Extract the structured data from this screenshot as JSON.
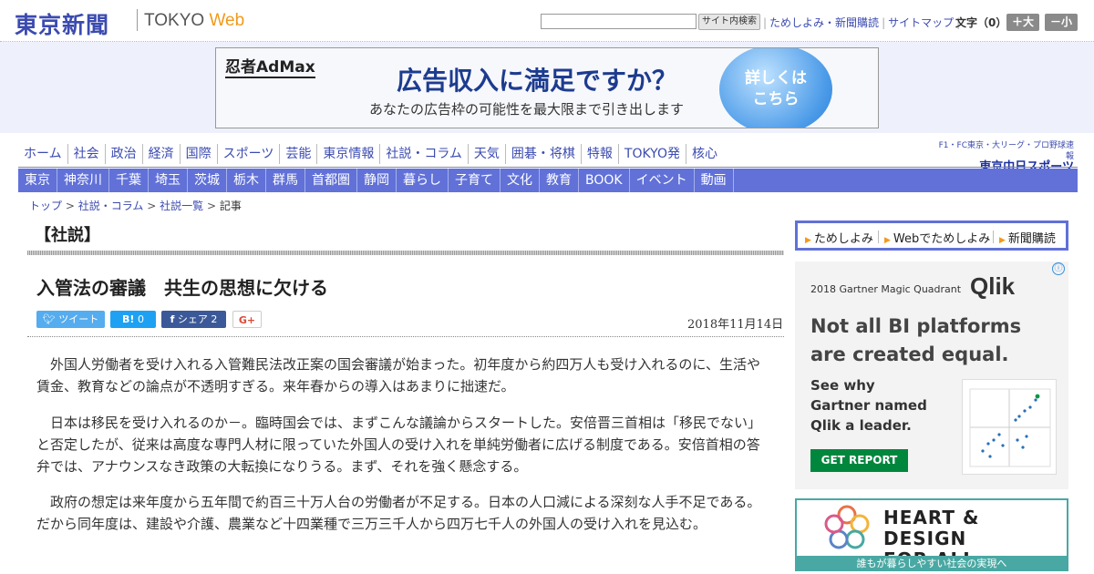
{
  "header": {
    "logo_jp": "東京新聞",
    "logo_en": "TOKYO",
    "logo_web": "Web",
    "search_button": "サイト内検索",
    "search_value": "",
    "link_trial": "ためしよみ・新聞購読",
    "link_sitemap": "サイトマップ",
    "font_size_label": "文字（0）",
    "size_up": "＋大",
    "size_down": "－小"
  },
  "top_ad": {
    "brand": "忍者AdMax",
    "headline": "広告収入に満足ですか？",
    "sub": "あなたの広告枠の可能性を最大限まで引き出します",
    "cta_line1": "詳しくは",
    "cta_line2": "こちら"
  },
  "nav_primary": [
    "ホーム",
    "社会",
    "政治",
    "経済",
    "国際",
    "スポーツ",
    "芸能",
    "東京情報",
    "社説・コラム",
    "天気",
    "囲碁・将棋",
    "特報",
    "TOKYO発",
    "核心"
  ],
  "sports_link": {
    "caption": "F1・FC東京・大リーグ・プロ野球速報",
    "logo": "東京中日スポーツ"
  },
  "nav_regional": [
    "東京",
    "神奈川",
    "千葉",
    "埼玉",
    "茨城",
    "栃木",
    "群馬",
    "首都圏",
    "静岡",
    "暮らし",
    "子育て",
    "文化",
    "教育",
    "BOOK",
    "イベント",
    "動画"
  ],
  "breadcrumb": [
    "トップ",
    "社説・コラム",
    "社説一覧",
    "記事"
  ],
  "article": {
    "section": "【社説】",
    "title": "入管法の審議　共生の思想に欠ける",
    "date": "2018年11月14日",
    "share": {
      "tweet": "ツイート",
      "hatena": "B!",
      "hatena_count": "0",
      "facebook": "シェア",
      "facebook_count": "2",
      "gplus": "G+"
    },
    "paragraphs": [
      "外国人労働者を受け入れる入管難民法改正案の国会審議が始まった。初年度から約四万人も受け入れるのに、生活や賃金、教育などの論点が不透明すぎる。来年春からの導入はあまりに拙速だ。",
      "日本は移民を受け入れるのか－。臨時国会では、まずこんな議論からスタートした。安倍晋三首相は「移民でない」と否定したが、従来は高度な専門人材に限っていた外国人の受け入れを単純労働者に広げる制度である。安倍首相の答弁では、アナウンスなき政策の大転換になりうる。まず、それを強く懸念する。",
      "政府の想定は来年度から五年間で約百三十万人台の労働者が不足する。日本の人口減による深刻な人手不足である。だから同年度は、建設や介護、農業など十四業種で三万三千人から四万七千人の外国人の受け入れを見込む。"
    ]
  },
  "sidebar": {
    "subscribe": [
      "ためしよみ",
      "Webでためしよみ",
      "新聞購読"
    ],
    "qlik_ad": {
      "eyebrow": "2018 Gartner Magic Quadrant",
      "logo": "Qlik",
      "headline_1": "Not all BI platforms",
      "headline_2": "are created equal.",
      "see_1": "See why",
      "see_2": "Gartner named",
      "see_3": "Qlik a leader.",
      "cta": "GET REPORT",
      "info_icon": "ⓘ",
      "close_icon": "✕"
    },
    "hd_ad": {
      "title_1": "HEART & DESIGN",
      "title_2": "FOR ALL",
      "footer": "誰もが暮らしやすい社会の実現へ"
    }
  },
  "colors": {
    "brand_blue": "#3b4bb0",
    "nav_blue": "#6171d8",
    "accent_orange": "#f19a1b",
    "qlik_green": "#00873d",
    "hd_teal": "#49a8a3"
  }
}
